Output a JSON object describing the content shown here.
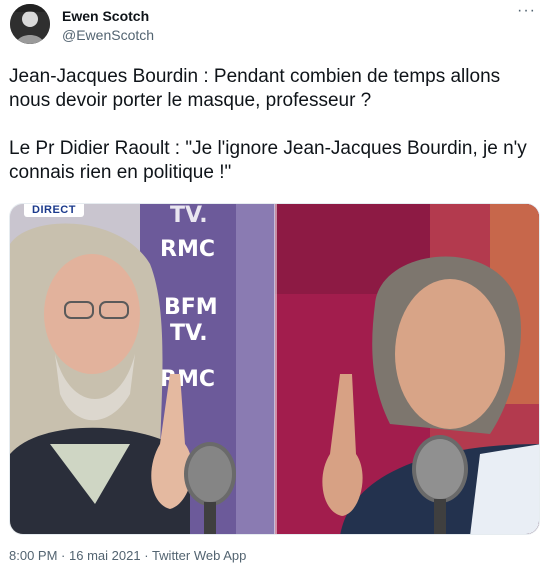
{
  "author": {
    "name": "Ewen Scotch",
    "handle": "@EwenScotch"
  },
  "more_icon": "···",
  "tweet": {
    "paragraph_1": "Jean-Jacques Bourdin : Pendant combien de temps allons nous devoir porter le masque, professeur ?",
    "paragraph_2": "Le Pr Didier Raoult : \"Je l'ignore Jean-Jacques Bourdin, je n'y connais rien en politique !\""
  },
  "media": {
    "badge": "DIRECT",
    "backdrop_text": {
      "rmc_1": "RMC",
      "bfm": "BFM",
      "tv": "TV.",
      "rmc_2": "RMC",
      "top_tv": "TV."
    },
    "colors": {
      "left_backdrop": "#6c5a9a",
      "right_backdrop": "#a21d4d",
      "badge_text": "#1b3a8c"
    }
  },
  "meta": {
    "time": "8:00 PM",
    "separator": "·",
    "date": "16 mai 2021",
    "source": "Twitter Web App"
  },
  "icons": {
    "more": "more-dots-icon",
    "avatar": "avatar"
  }
}
